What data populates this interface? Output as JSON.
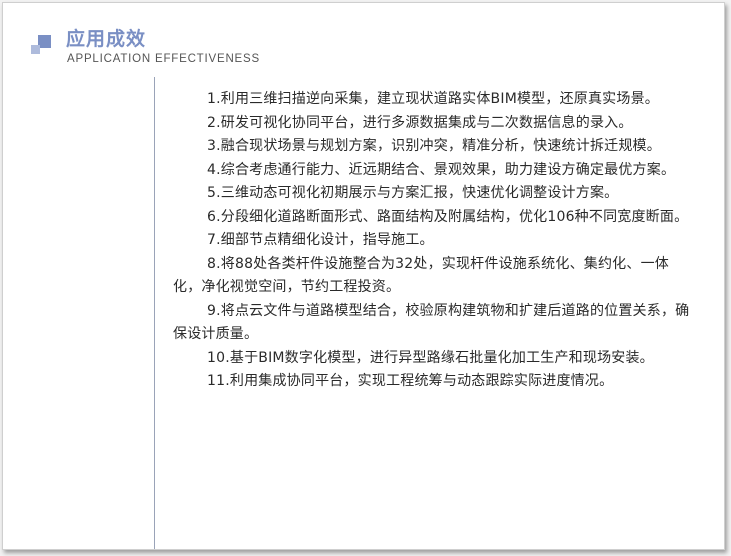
{
  "header": {
    "title_cn": "应用成效",
    "title_en": "APPLICATION EFFECTIVENESS"
  },
  "items": [
    "1.利用三维扫描逆向采集，建立现状道路实体BIM模型，还原真实场景。",
    "2.研发可视化协同平台，进行多源数据集成与二次数据信息的录入。",
    "3.融合现状场景与规划方案，识别冲突，精准分析，快速统计拆迁规模。",
    "4.综合考虑通行能力、近远期结合、景观效果，助力建设方确定最优方案。",
    "5.三维动态可视化初期展示与方案汇报，快速优化调整设计方案。",
    "6.分段细化道路断面形式、路面结构及附属结构，优化106种不同宽度断面。",
    "7.细部节点精细化设计，指导施工。",
    "8.将88处各类杆件设施整合为32处，实现杆件设施系统化、集约化、一体化，净化视觉空间，节约工程投资。",
    "9.将点云文件与道路模型结合，校验原构建筑物和扩建后道路的位置关系，确保设计质量。",
    "10.基于BIM数字化模型，进行异型路缘石批量化加工生产和现场安装。",
    "11.利用集成协同平台，实现工程统筹与动态跟踪实际进度情况。"
  ],
  "colors": {
    "accent": "#7a8fc4",
    "accent_light": "#aebbdc",
    "text": "#2a2a2a"
  }
}
